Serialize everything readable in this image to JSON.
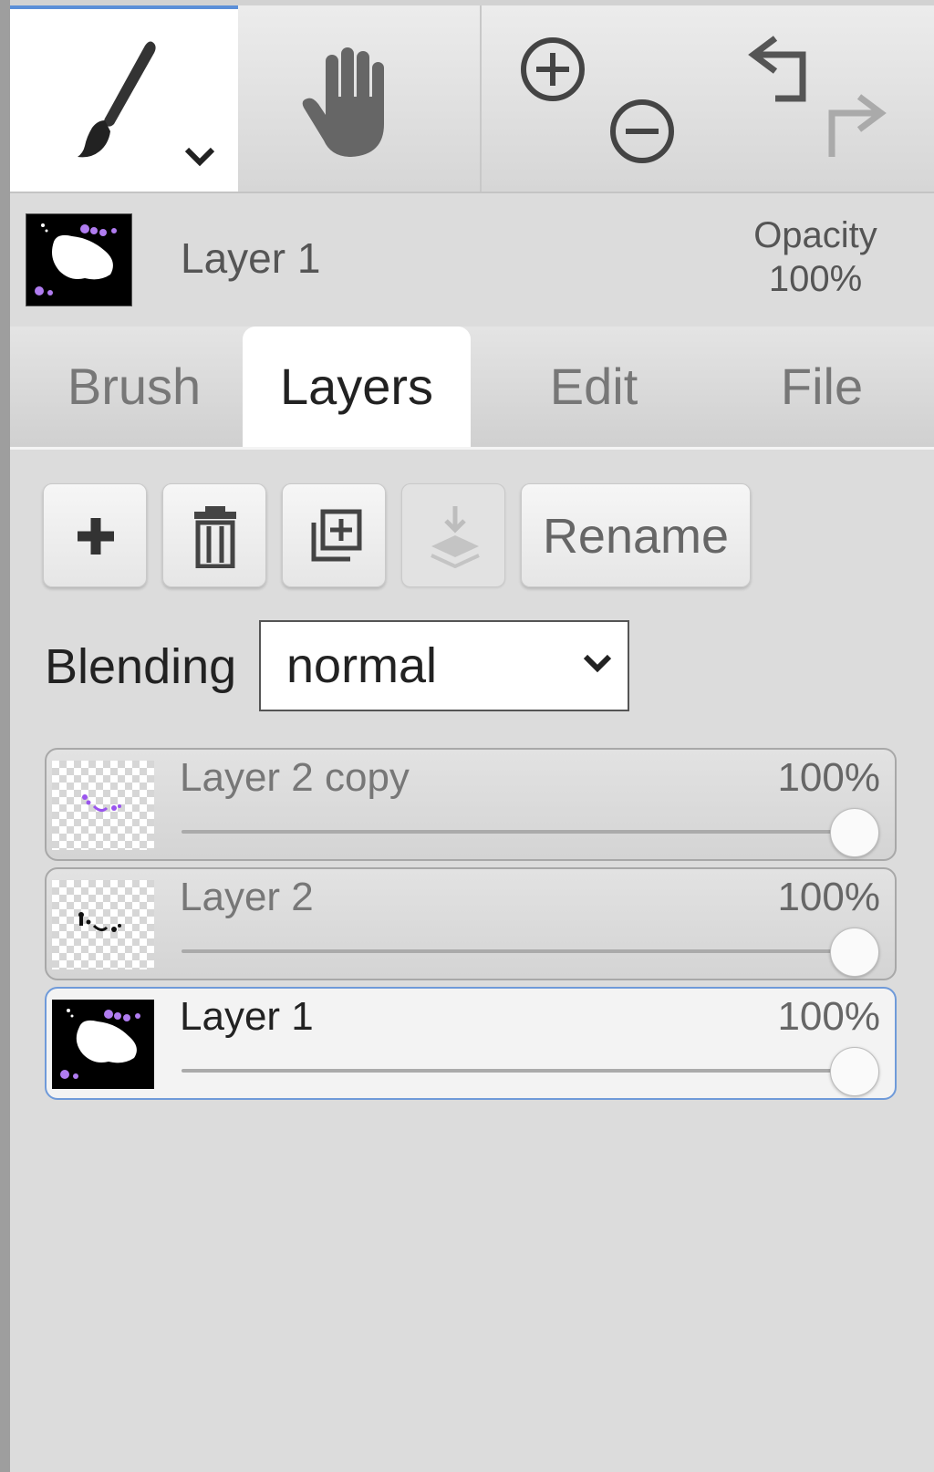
{
  "toolbar": {
    "tools": [
      {
        "name": "brush-tool",
        "icon": "paintbrush-icon",
        "active": true
      },
      {
        "name": "hand-tool",
        "icon": "hand-icon"
      },
      {
        "name": "zoom-tool",
        "icons": [
          "zoom-in-icon",
          "zoom-out-icon"
        ]
      },
      {
        "name": "history-tool",
        "icons": [
          "undo-icon",
          "redo-icon"
        ]
      }
    ]
  },
  "current_layer": {
    "name": "Layer 1",
    "opacity_label": "Opacity",
    "opacity_value": "100%"
  },
  "tabs": [
    {
      "label": "Brush",
      "active": false
    },
    {
      "label": "Layers",
      "active": true
    },
    {
      "label": "Edit",
      "active": false
    },
    {
      "label": "File",
      "active": false
    }
  ],
  "layer_actions": {
    "buttons": [
      "plus-icon",
      "trash-icon",
      "duplicate-icon",
      "merge-down-icon"
    ],
    "rename_label": "Rename"
  },
  "blending": {
    "label": "Blending",
    "value": "normal"
  },
  "layers": [
    {
      "name": "Layer 2 copy",
      "opacity": "100%",
      "opacity_fraction": 1.0,
      "selected": false
    },
    {
      "name": "Layer 2",
      "opacity": "100%",
      "opacity_fraction": 1.0,
      "selected": false
    },
    {
      "name": "Layer 1",
      "opacity": "100%",
      "opacity_fraction": 1.0,
      "selected": true
    }
  ],
  "colors": {
    "accent": "#5b8fd8",
    "selected_border": "#6f9ad9",
    "thumb_purple": "#b07cf0"
  }
}
